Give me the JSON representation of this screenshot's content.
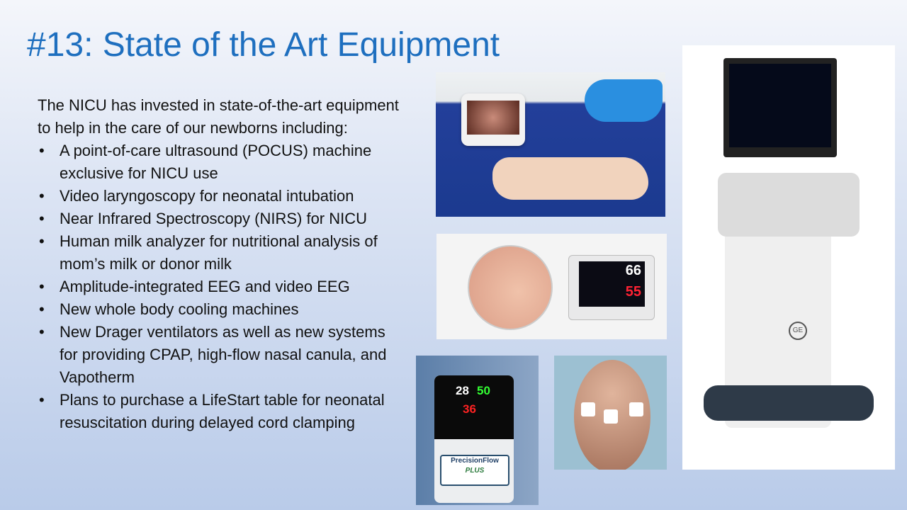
{
  "slide": {
    "title": "#13: State of the Art Equipment",
    "intro": "The NICU has invested in state-of-the-art equipment to help in the care of our newborns including:",
    "bullets": [
      "A point-of-care ultrasound (POCUS) machine exclusive for NICU use",
      "Video laryngoscopy for neonatal intubation",
      "Near Infrared Spectroscopy (NIRS) for NICU",
      "Human milk analyzer for nutritional analysis of mom’s milk or donor milk",
      "Amplitude-integrated EEG and video EEG",
      "New whole body cooling machines",
      "New Drager ventilators as well as new systems for providing CPAP, high-flow nasal canula, and Vapotherm",
      "Plans to purchase a LifeStart table for neonatal resuscitation during delayed cord clamping"
    ],
    "bullet_char": "•"
  },
  "images": {
    "nirs_monitor": {
      "left": "66",
      "right": "55"
    },
    "precision_flow": {
      "flow": "28",
      "o2": "50",
      "temp": "36",
      "brand": "PrecisionFlow",
      "brand_sub": "PLUS"
    },
    "ultrasound_logo": "GE"
  },
  "colors": {
    "title": "#1e6fbf"
  }
}
